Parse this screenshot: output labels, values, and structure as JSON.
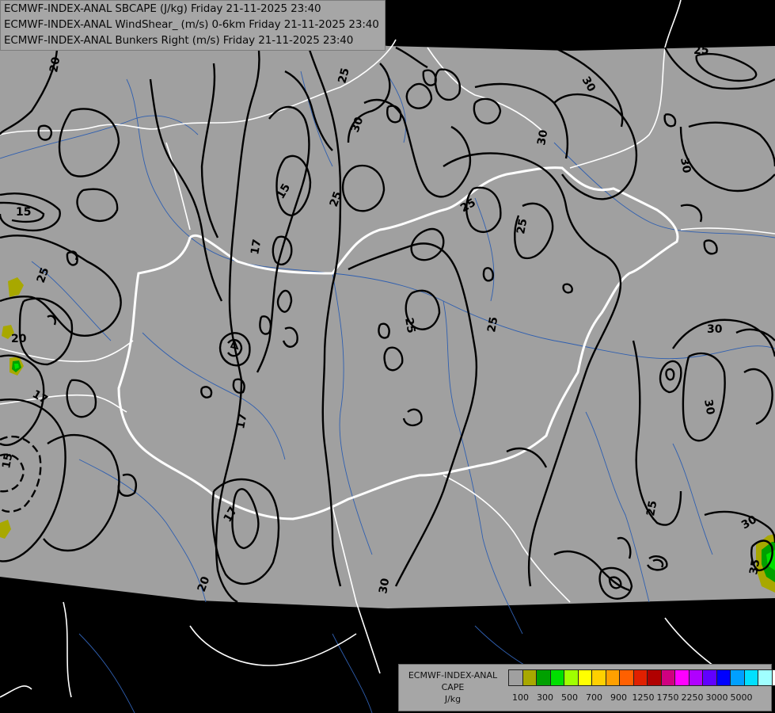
{
  "header": {
    "lines": [
      "ECMWF-INDEX-ANAL SBCAPE (J/kg) Friday 21-11-2025 23:40",
      "ECMWF-INDEX-ANAL WindShear_ (m/s) 0-6km Friday 21-11-2025 23:40",
      "ECMWF-INDEX-ANAL Bunkers Right (m/s) Friday 21-11-2025 23:40"
    ]
  },
  "contour_labels": [
    "20",
    "25",
    "30",
    "25",
    "30",
    "30",
    "25",
    "25",
    "25",
    "15",
    "17",
    "25",
    "25",
    "25",
    "30",
    "15",
    "20",
    "17",
    "15",
    "17",
    "17",
    "20",
    "30",
    "25",
    "30",
    "30",
    "30",
    "35"
  ],
  "legend": {
    "caption": [
      "ECMWF-INDEX-ANAL",
      "CAPE",
      "J/kg"
    ],
    "colors": [
      "#a0a0a0",
      "#a8a800",
      "#00a000",
      "#00e000",
      "#a0ff00",
      "#ffff00",
      "#ffd000",
      "#ffa000",
      "#ff6000",
      "#e02000",
      "#b00000",
      "#d00080",
      "#ff00ff",
      "#b000ff",
      "#6000ff",
      "#0000ff",
      "#00a0ff",
      "#00e0ff",
      "#a0ffff",
      "#ffffff"
    ],
    "ticks": [
      "100",
      "300",
      "500",
      "700",
      "900",
      "1250",
      "1750",
      "2250",
      "3000",
      "5000"
    ]
  },
  "cape_cells": {
    "colors": {
      "yellow": "#a8a800",
      "green": "#00a000",
      "light_green": "#00e000"
    }
  }
}
